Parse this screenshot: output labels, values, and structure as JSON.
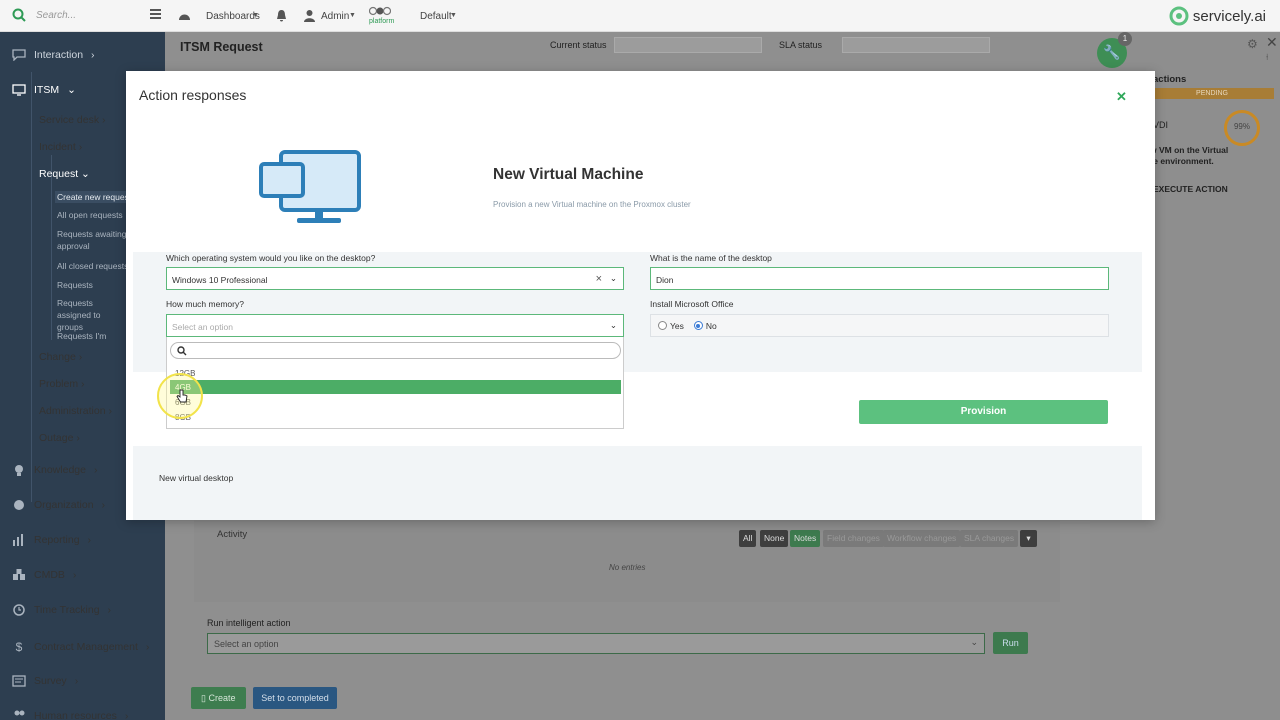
{
  "topbar": {
    "search_placeholder": "Search...",
    "dashboards": "Dashboards",
    "admin": "Admin",
    "platform": "platform",
    "default": "Default",
    "brand": "servicely.ai"
  },
  "sidebar": {
    "interaction": "Interaction",
    "itsm": "ITSM",
    "service_desk": "Service desk",
    "incident": "Incident",
    "request": "Request",
    "request_items": [
      "Create new request",
      "All open requests",
      "Requests awaiting approval",
      "All closed requests",
      "Requests assigned to me",
      "Requests assigned to groups",
      "Requests I'm following"
    ],
    "change": "Change",
    "problem": "Problem",
    "administration": "Administration",
    "outage": "Outage",
    "knowledge": "Knowledge",
    "organization": "Organization",
    "reporting": "Reporting",
    "cmdb": "CMDB",
    "time_tracking": "Time Tracking",
    "contract_management": "Contract Management",
    "survey": "Survey",
    "human_resources": "Human resources"
  },
  "page": {
    "title": "ITSM Request",
    "current_status": "Current status",
    "sla_status": "SLA status",
    "activity": "Activity",
    "filters": [
      "All",
      "None",
      "Notes",
      "Field changes",
      "Workflow changes",
      "SLA changes"
    ],
    "no_entries": "No entries",
    "run_intelligent_action": "Run intelligent action",
    "select_option": "Select an option",
    "run": "Run",
    "create": "Create",
    "set_to_completed": "Set to completed"
  },
  "right_panel": {
    "badge": "1",
    "actions": "actions",
    "pending": "PENDING",
    "vdi": "VDI",
    "desc": "w VM on the Virtual re environment.",
    "percent": "99%",
    "execute": "EXECUTE ACTION"
  },
  "modal": {
    "title": "Action responses",
    "heading": "New Virtual Machine",
    "subheading": "Provision a new Virtual machine on the Proxmox cluster",
    "os_question": "Which operating system would you like on the desktop?",
    "os_value": "Windows 10 Professional",
    "name_question": "What is the name of the desktop",
    "name_value": "Dion",
    "memory_question": "How much memory?",
    "memory_placeholder": "Select an option",
    "office_question": "Install Microsoft Office",
    "yes": "Yes",
    "no": "No",
    "memory_options": [
      "12GB",
      "4GB",
      "6GB",
      "8GB"
    ],
    "provision": "Provision",
    "footer": "New virtual desktop"
  },
  "colors": {
    "accent_green": "#5cc17f",
    "sidebar_bg": "#2d3e50",
    "selected_option": "#4cad66"
  }
}
